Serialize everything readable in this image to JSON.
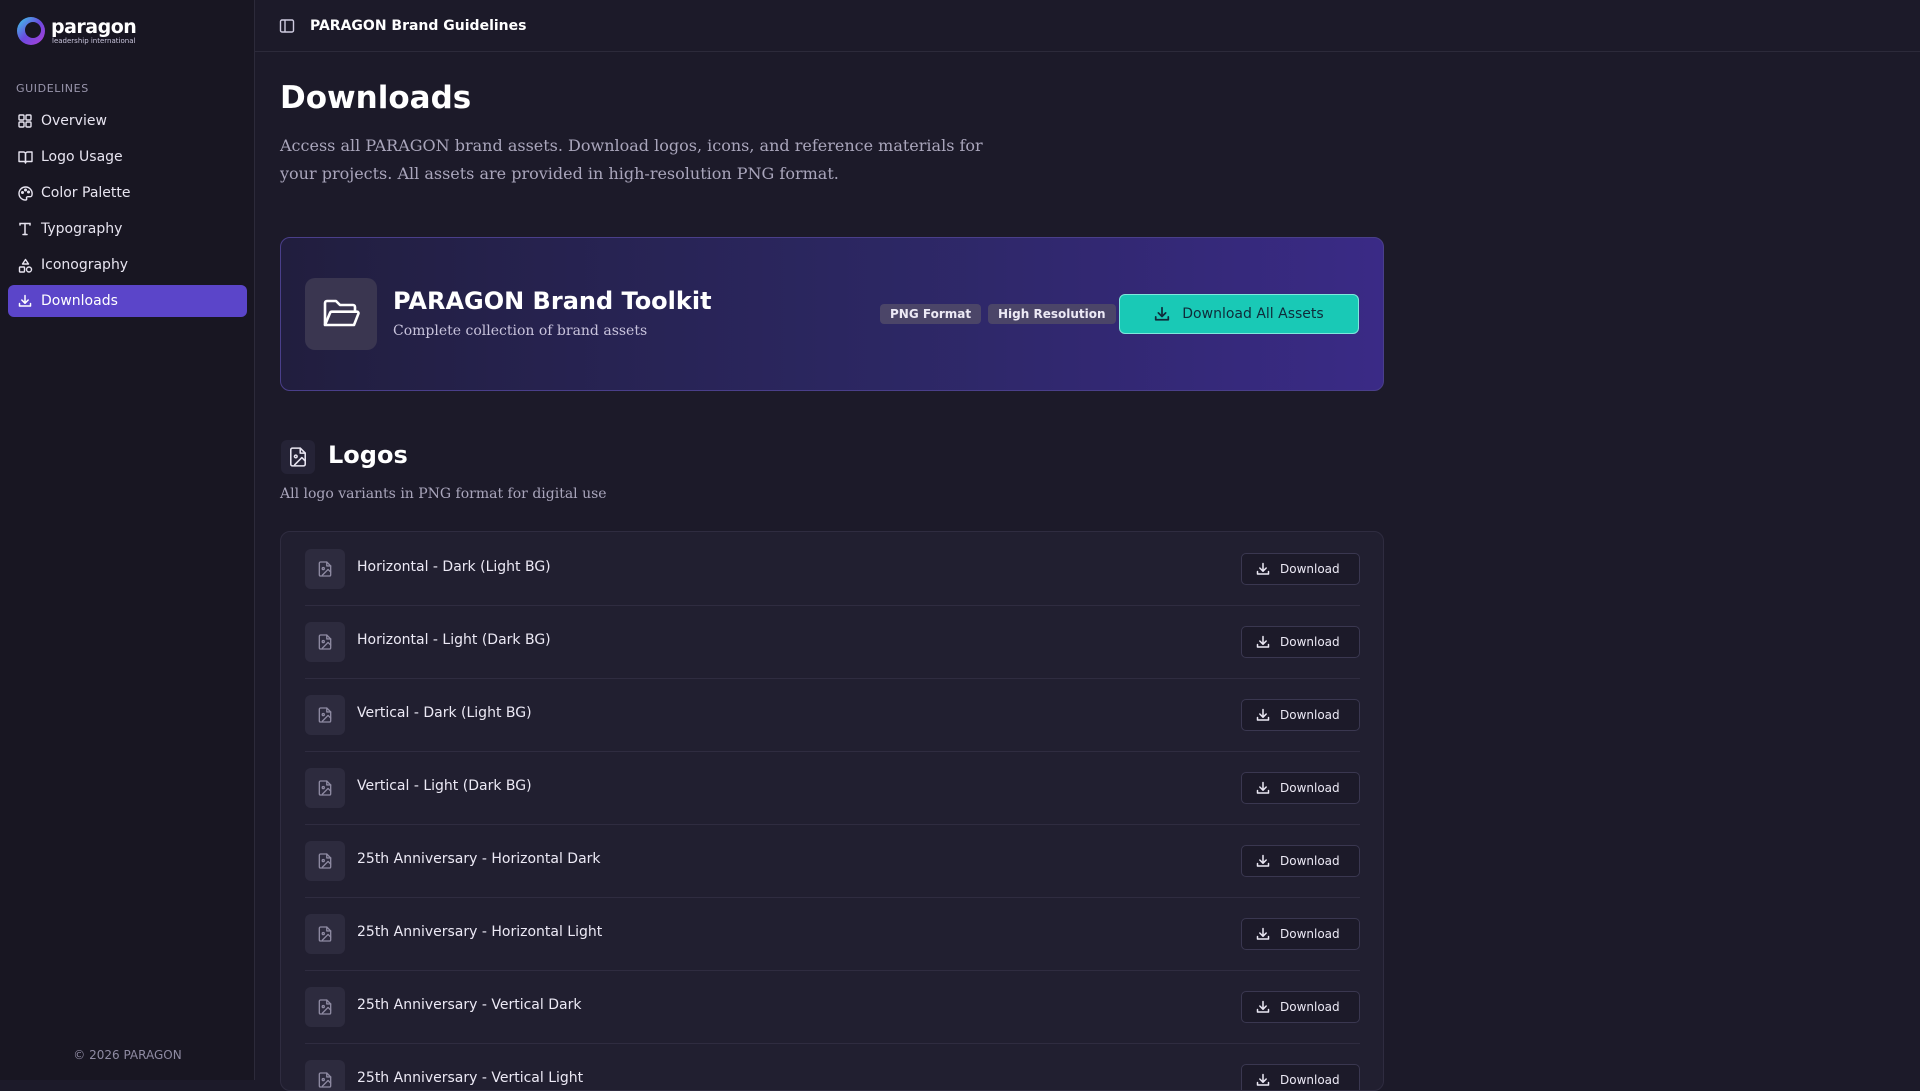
{
  "brand": {
    "name": "paragon",
    "tagline": "leadership international"
  },
  "sidebar": {
    "section_label": "GUIDELINES",
    "items": [
      {
        "label": "Overview",
        "icon": "grid-icon",
        "active": false
      },
      {
        "label": "Logo Usage",
        "icon": "book-icon",
        "active": false
      },
      {
        "label": "Color Palette",
        "icon": "palette-icon",
        "active": false
      },
      {
        "label": "Typography",
        "icon": "type-icon",
        "active": false
      },
      {
        "label": "Iconography",
        "icon": "shapes-icon",
        "active": false
      },
      {
        "label": "Downloads",
        "icon": "download-icon",
        "active": true
      }
    ],
    "footer": "© 2026 PARAGON"
  },
  "topbar": {
    "title": "PARAGON Brand Guidelines"
  },
  "page": {
    "title": "Downloads",
    "description": "Access all PARAGON brand assets. Download logos, icons, and reference materials for your projects. All assets are provided in high-resolution PNG format."
  },
  "toolkit": {
    "title": "PARAGON Brand Toolkit",
    "subtitle": "Complete collection of brand assets",
    "badges": [
      "PNG Format",
      "High Resolution"
    ],
    "button_label": "Download All Assets"
  },
  "logos": {
    "title": "Logos",
    "subtitle": "All logo variants in PNG format for digital use",
    "button_label": "Download",
    "items": [
      "Horizontal - Dark (Light BG)",
      "Horizontal - Light (Dark BG)",
      "Vertical - Dark (Light BG)",
      "Vertical - Light (Dark BG)",
      "25th Anniversary - Horizontal Dark",
      "25th Anniversary - Horizontal Light",
      "25th Anniversary - Vertical Dark",
      "25th Anniversary - Vertical Light"
    ]
  },
  "colors": {
    "accent": "#5b45c9",
    "cta": "#19c9b6",
    "background": "#1c1a29"
  }
}
